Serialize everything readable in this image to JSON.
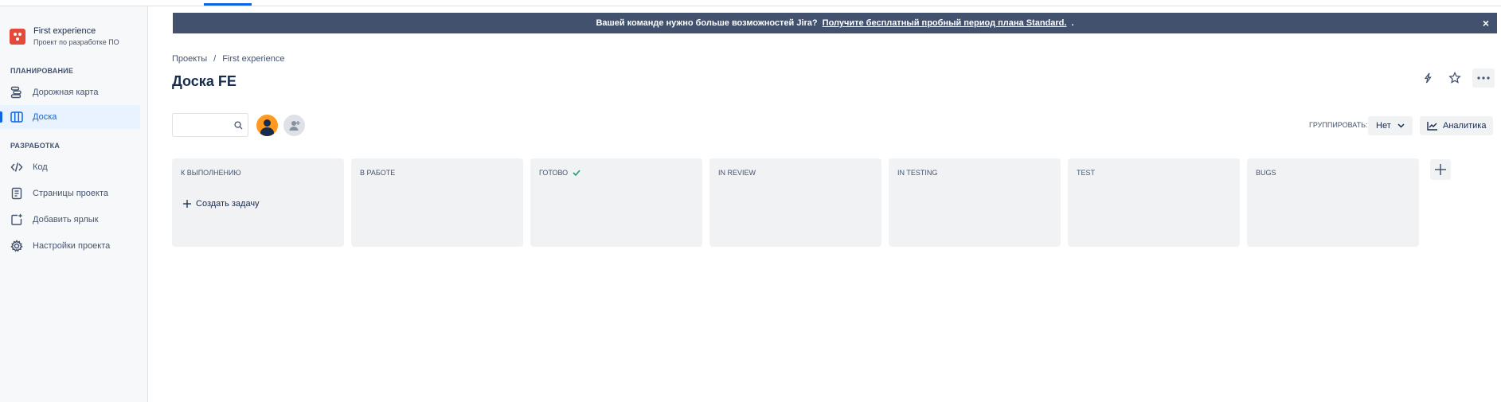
{
  "project": {
    "name": "First experience",
    "subtitle": "Проект по разработке ПО"
  },
  "sidebar": {
    "section_planning": "ПЛАНИРОВАНИЕ",
    "section_dev": "РАЗРАБОТКА",
    "items": [
      {
        "label": "Дорожная карта",
        "icon": "roadmap-icon"
      },
      {
        "label": "Доска",
        "icon": "board-icon",
        "active": true
      },
      {
        "label": "Код",
        "icon": "code-icon"
      },
      {
        "label": "Страницы проекта",
        "icon": "pages-icon"
      },
      {
        "label": "Добавить ярлык",
        "icon": "add-shortcut-icon"
      },
      {
        "label": "Настройки проекта",
        "icon": "gear-icon"
      }
    ]
  },
  "banner": {
    "text": "Вашей команде нужно больше возможностей Jira?",
    "link": "Получите бесплатный пробный период плана Standard.",
    "suffix": ".",
    "close": "×"
  },
  "breadcrumb": {
    "root": "Проекты",
    "separator": "/",
    "current": "First experience"
  },
  "page": {
    "title": "Доска FE"
  },
  "toolbar": {
    "group_label": "ГРУППИРОВАТЬ:",
    "group_value": "Нет",
    "analytics": "Аналитика"
  },
  "columns": [
    {
      "title": "К выполнению",
      "create": "Создать задачу"
    },
    {
      "title": "В работе"
    },
    {
      "title": "Готово",
      "done": true
    },
    {
      "title": "IN REVIEW"
    },
    {
      "title": "IN TESTING"
    },
    {
      "title": "TEST"
    },
    {
      "title": "BUGS"
    }
  ],
  "colors": {
    "accent": "#0c66e4",
    "banner": "#42526e",
    "done_check": "#22a06b",
    "project_avatar": "#e5493a"
  }
}
